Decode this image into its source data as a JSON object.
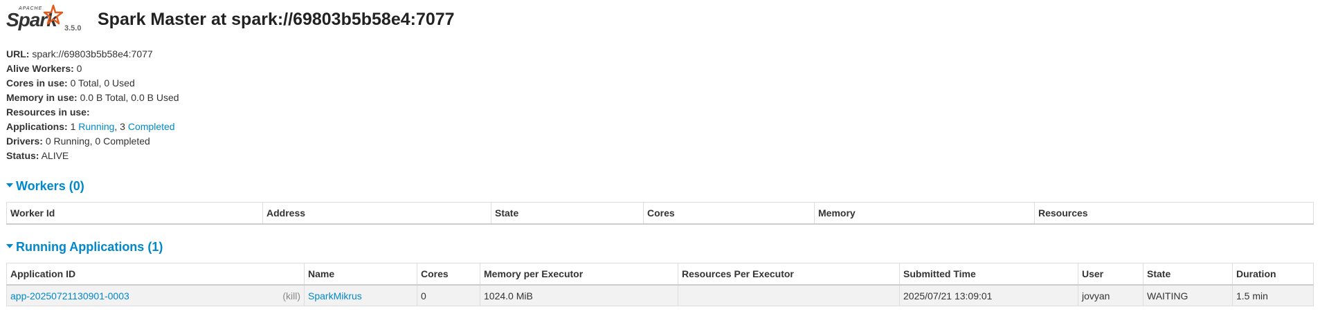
{
  "header": {
    "logo_apache": "APACHE",
    "logo_spark": "Spark",
    "version": "3.5.0",
    "title": "Spark Master at spark://69803b5b58e4:7077"
  },
  "summary": {
    "url_label": "URL:",
    "url_value": "spark://69803b5b58e4:7077",
    "alive_workers_label": "Alive Workers:",
    "alive_workers_value": "0",
    "cores_label": "Cores in use:",
    "cores_value": "0 Total, 0 Used",
    "memory_label": "Memory in use:",
    "memory_value": "0.0 B Total, 0.0 B Used",
    "resources_label": "Resources in use:",
    "applications_label": "Applications:",
    "applications_running_count": "1",
    "applications_running_link": "Running",
    "applications_sep": ", 3",
    "applications_completed_link": "Completed",
    "drivers_label": "Drivers:",
    "drivers_value": "0 Running, 0 Completed",
    "status_label": "Status:",
    "status_value": "ALIVE"
  },
  "workers": {
    "title": "Workers (0)",
    "columns": [
      "Worker Id",
      "Address",
      "State",
      "Cores",
      "Memory",
      "Resources"
    ]
  },
  "running_apps": {
    "title": "Running Applications (1)",
    "columns": [
      "Application ID",
      "Name",
      "Cores",
      "Memory per Executor",
      "Resources Per Executor",
      "Submitted Time",
      "User",
      "State",
      "Duration"
    ],
    "rows": [
      {
        "app_id": "app-20250721130901-0003",
        "kill": "(kill)",
        "name": "SparkMikrus",
        "cores": "0",
        "memory": "1024.0 MiB",
        "resources": "",
        "submitted": "2025/07/21 13:09:01",
        "user": "jovyan",
        "state": "WAITING",
        "duration": "1.5 min"
      }
    ]
  },
  "colors": {
    "link": "#0088cc",
    "text": "#333333",
    "row_bg": "#f2f2f2",
    "logo_star": "#e25a1c"
  }
}
